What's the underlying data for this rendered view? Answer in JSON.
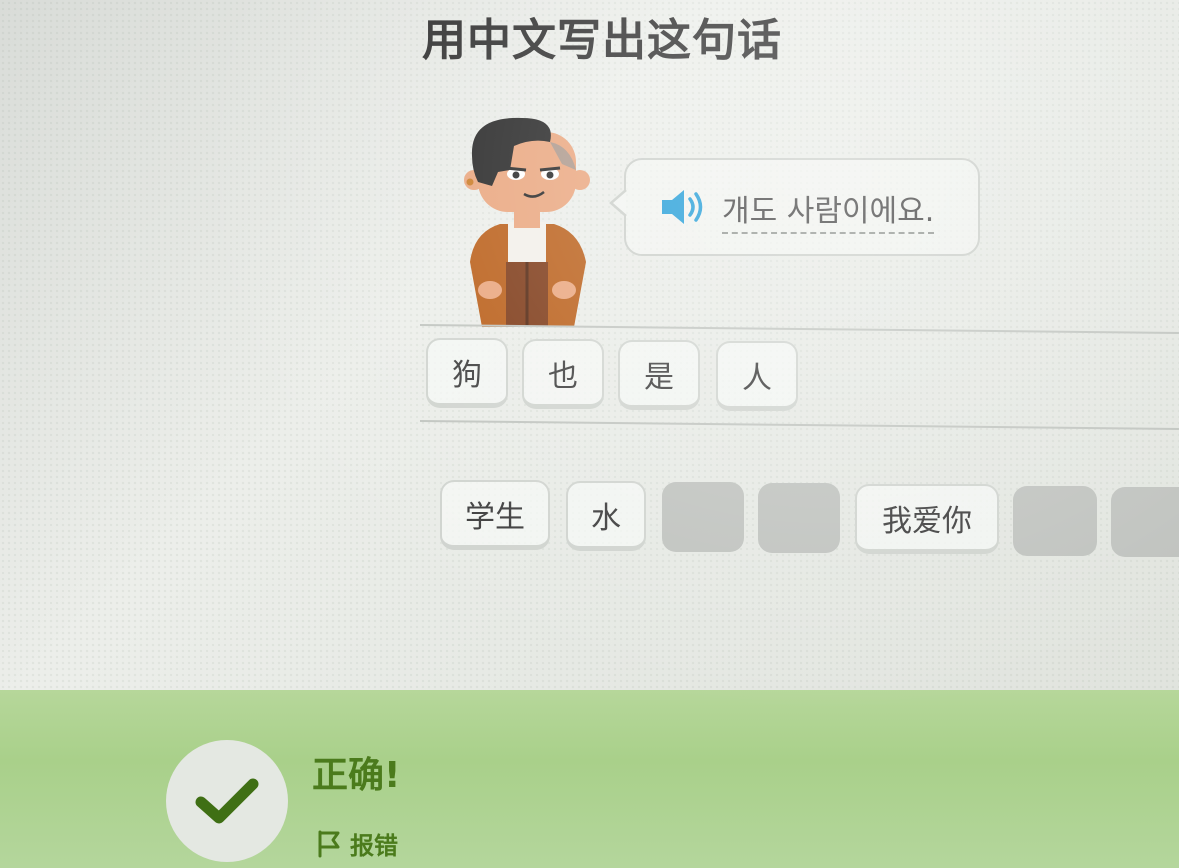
{
  "header": {
    "title": "用中文写出这句话"
  },
  "prompt": {
    "speaker_icon": "speaker-icon",
    "sentence": "개도 사람이에요."
  },
  "answer": {
    "tiles": [
      "狗",
      "也",
      "是",
      "人"
    ]
  },
  "word_bank": {
    "tiles": [
      {
        "label": "学生",
        "used": false
      },
      {
        "label": "水",
        "used": false
      },
      {
        "label": "",
        "used": true
      },
      {
        "label": "",
        "used": true
      },
      {
        "label": "我爱你",
        "used": false
      },
      {
        "label": "",
        "used": true
      },
      {
        "label": "",
        "used": true
      }
    ]
  },
  "feedback": {
    "title": "正确!",
    "icon": "checkmark-icon",
    "report_icon": "flag-icon",
    "report_label": "报错"
  },
  "colors": {
    "correct_green": "#4b7b1c",
    "banner_green": "#a9d08a",
    "speaker_blue": "#1899d6",
    "jacket_orange": "#b85a12"
  }
}
